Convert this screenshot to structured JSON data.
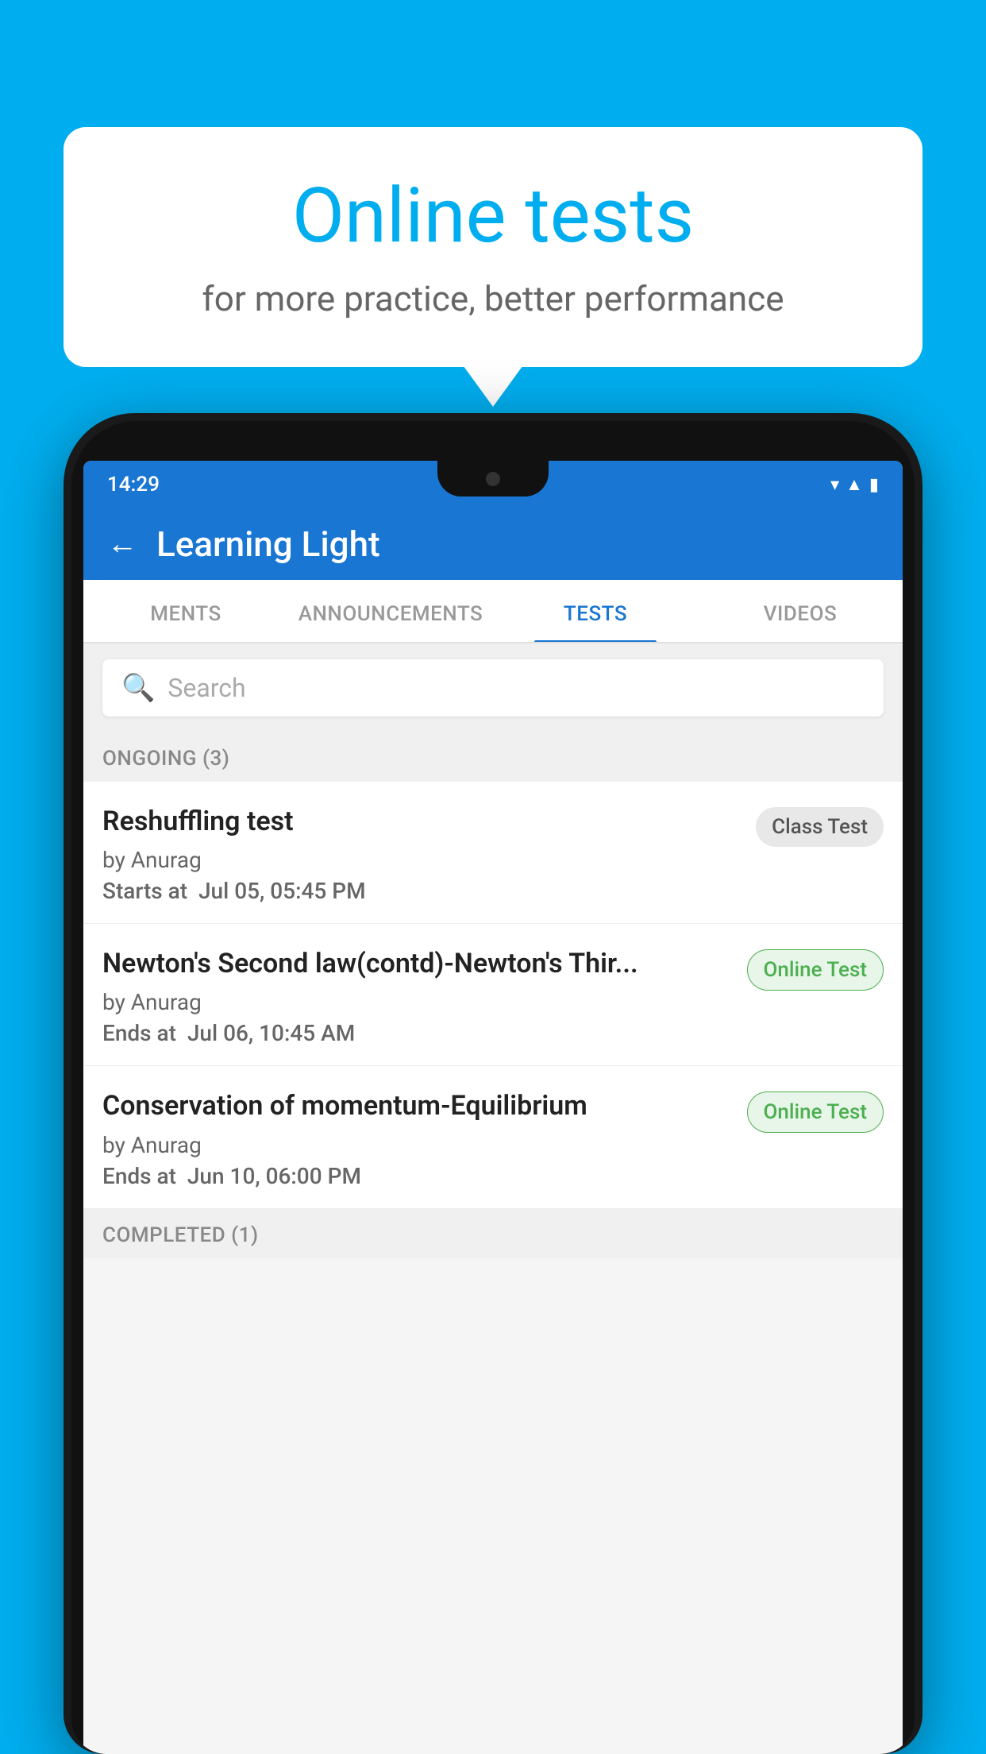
{
  "background_color": "#00AEEF",
  "speech_bubble": {
    "title": "Online tests",
    "subtitle": "for more practice, better performance"
  },
  "phone": {
    "status_bar": {
      "time": "14:29",
      "icons": [
        "wifi",
        "signal",
        "battery"
      ]
    },
    "app_header": {
      "back_label": "←",
      "title": "Learning Light"
    },
    "tabs": [
      {
        "label": "MENTS",
        "active": false
      },
      {
        "label": "ANNOUNCEMENTS",
        "active": false
      },
      {
        "label": "TESTS",
        "active": true
      },
      {
        "label": "VIDEOS",
        "active": false
      }
    ],
    "search": {
      "placeholder": "Search"
    },
    "sections": [
      {
        "label": "ONGOING (3)",
        "tests": [
          {
            "name": "Reshuffling test",
            "author": "by Anurag",
            "time_label": "Starts at",
            "time_value": "Jul 05, 05:45 PM",
            "badge": "Class Test",
            "badge_type": "class"
          },
          {
            "name": "Newton's Second law(contd)-Newton's Thir...",
            "author": "by Anurag",
            "time_label": "Ends at",
            "time_value": "Jul 06, 10:45 AM",
            "badge": "Online Test",
            "badge_type": "online"
          },
          {
            "name": "Conservation of momentum-Equilibrium",
            "author": "by Anurag",
            "time_label": "Ends at",
            "time_value": "Jun 10, 06:00 PM",
            "badge": "Online Test",
            "badge_type": "online"
          }
        ]
      }
    ],
    "completed_section_label": "COMPLETED (1)"
  }
}
